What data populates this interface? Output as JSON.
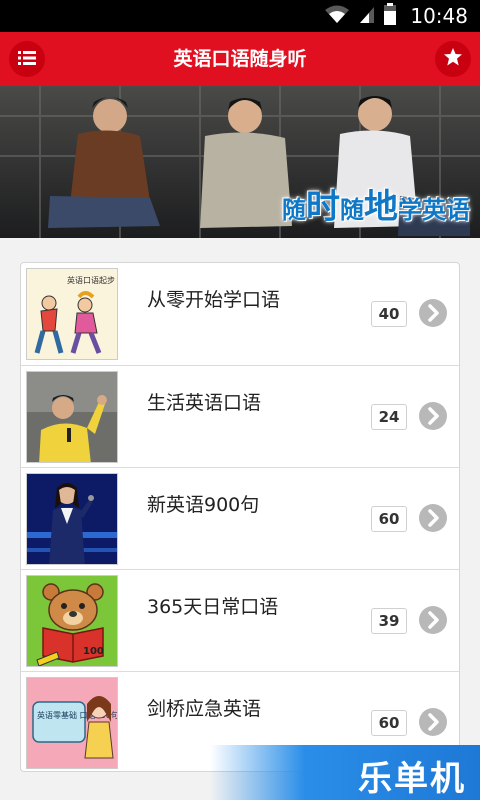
{
  "status_bar": {
    "time": "10:48",
    "icons": [
      "wifi-icon",
      "signal-icon",
      "battery-icon"
    ]
  },
  "header": {
    "title": "英语口语随身听",
    "left_icon": "menu-list-icon",
    "right_icon": "star-icon",
    "color": "#e01020"
  },
  "banner": {
    "slogan": [
      "随",
      "时",
      "随",
      "地",
      "学英语"
    ]
  },
  "list": {
    "items": [
      {
        "title": "从零开始学口语",
        "count": "40",
        "thumb_caption": "英语口语起步"
      },
      {
        "title": "生活英语口语",
        "count": "24"
      },
      {
        "title": "新英语900句",
        "count": "60"
      },
      {
        "title": "365天日常口语",
        "count": "39"
      },
      {
        "title": "剑桥应急英语",
        "count": "60",
        "thumb_caption": "英语零基础 口语100句"
      }
    ]
  },
  "watermark": {
    "text": "乐单机"
  }
}
